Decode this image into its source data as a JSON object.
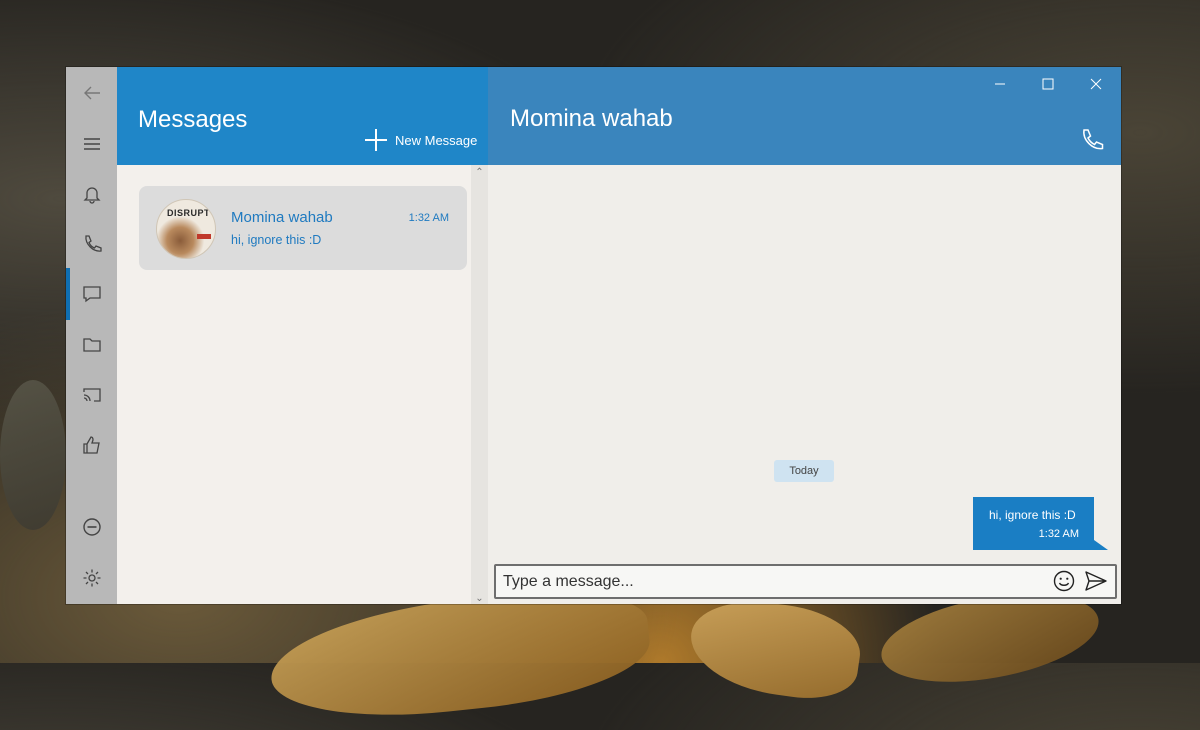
{
  "app": {
    "list_title": "Messages",
    "new_message_label": "New Message"
  },
  "rail": {
    "items": [
      "back-arrow-icon",
      "hamburger-menu-icon",
      "bell-icon",
      "phone-icon",
      "chat-icon",
      "folder-icon",
      "cast-icon",
      "thumbs-up-icon",
      "block-icon",
      "gear-icon"
    ],
    "active": "chat-icon"
  },
  "conversations": [
    {
      "name": "Momina wahab",
      "time": "1:32 AM",
      "preview": "hi, ignore this :D",
      "avatar_text": "DISRUPT"
    }
  ],
  "chat": {
    "title": "Momina wahab",
    "date_separator": "Today",
    "messages": [
      {
        "text": "hi, ignore this :D",
        "time": "1:32 AM",
        "outgoing": true
      }
    ],
    "composer_placeholder": "Type a message..."
  },
  "colors": {
    "list_header": "#1f86c8",
    "chat_header": "#3a85bd",
    "bubble": "#1a7ec4",
    "rail": "#b8b8b8"
  }
}
